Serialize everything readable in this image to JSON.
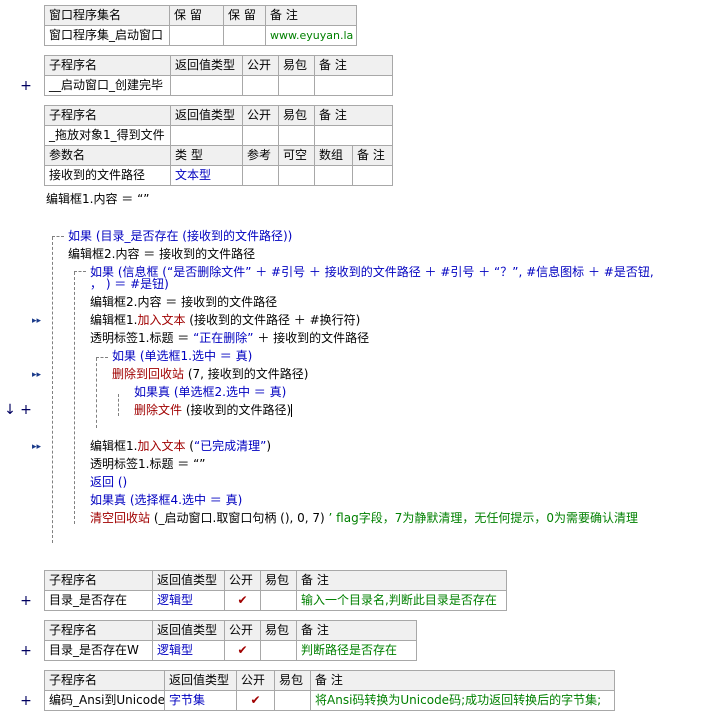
{
  "table1": {
    "headers": [
      "窗口程序集名",
      "保 留",
      "保 留",
      "备 注"
    ],
    "row": [
      "窗口程序集_启动窗口",
      "",
      "",
      "www.eyuyan.la"
    ]
  },
  "sub_created": {
    "headers": [
      "子程序名",
      "返回值类型",
      "公开",
      "易包",
      "备 注"
    ],
    "row": [
      "__启动窗口_创建完毕",
      "",
      "",
      "",
      ""
    ]
  },
  "sub_drop": {
    "headers": [
      "子程序名",
      "返回值类型",
      "公开",
      "易包",
      "备 注"
    ],
    "row": [
      "_拖放对象1_得到文件",
      "",
      "",
      "",
      ""
    ],
    "param_headers": [
      "参数名",
      "类 型",
      "参考",
      "可空",
      "数组",
      "备 注"
    ],
    "param_row": [
      "接收到的文件路径",
      "文本型",
      "",
      "",
      "",
      ""
    ]
  },
  "code": {
    "l1": "编辑框1.内容 ＝ “”",
    "l2": "如果 (目录_是否存在 (接收到的文件路径))",
    "l3": "编辑框2.内容 ＝ 接收到的文件路径",
    "l4": "如果 (信息框 (“是否删除文件” ＋ #引号 ＋ 接收到的文件路径 ＋ #引号 ＋ “？”, #信息图标 ＋ #是否钮,",
    "l4b": "， ) ＝ #是钮)",
    "l5": "编辑框2.内容 ＝ 接收到的文件路径",
    "l6_a": "编辑框1.",
    "l6_b": "加入文本",
    "l6_c": " (接收到的文件路径 ＋ #换行符)",
    "l7_a": "透明标签1.标题 ＝ ",
    "l7_b": "“正在删除”",
    "l7_c": " ＋ 接收到的文件路径",
    "l8": "如果 (单选框1.选中 ＝ 真)",
    "l9_a": "删除到回收站",
    "l9_b": " (7, 接收到的文件路径)",
    "l10": "如果真 (单选框2.选中 ＝ 真)",
    "l11_a": "删除文件",
    "l11_b": " (接收到的文件路径)",
    "l12_a": "编辑框1.",
    "l12_b": "加入文本",
    "l12_c": " (",
    "l12_d": "“已完成清理”",
    "l12_e": ")",
    "l13": "透明标签1.标题 ＝ “”",
    "l14": "返回 ()",
    "l15": "如果真 (选择框4.选中 ＝ 真)",
    "l16_a": "清空回收站",
    "l16_b": " (_启动窗口.取窗口句柄 (), 0, 7)  ",
    "l16_c": "’ flag字段，7为静默清理，无任何提示，0为需要确认清理"
  },
  "sub_dir_exists": {
    "headers": [
      "子程序名",
      "返回值类型",
      "公开",
      "易包",
      "备 注"
    ],
    "row": [
      "目录_是否存在",
      "逻辑型",
      "✔",
      "",
      "输入一个目录名,判断此目录是否存在"
    ]
  },
  "sub_dir_exists_w": {
    "headers": [
      "子程序名",
      "返回值类型",
      "公开",
      "易包",
      "备 注"
    ],
    "row": [
      "目录_是否存在W",
      "逻辑型",
      "✔",
      "",
      "判断路径是否存在"
    ]
  },
  "sub_ansi": {
    "headers": [
      "子程序名",
      "返回值类型",
      "公开",
      "易包",
      "备 注"
    ],
    "row": [
      "编码_Ansi到Unicode",
      "字节集",
      "✔",
      "",
      "将Ansi码转换为Unicode码;成功返回转换后的字节集;"
    ]
  },
  "gutter": {
    "plus": "+",
    "arrow": "▸▸",
    "down": "↓"
  }
}
